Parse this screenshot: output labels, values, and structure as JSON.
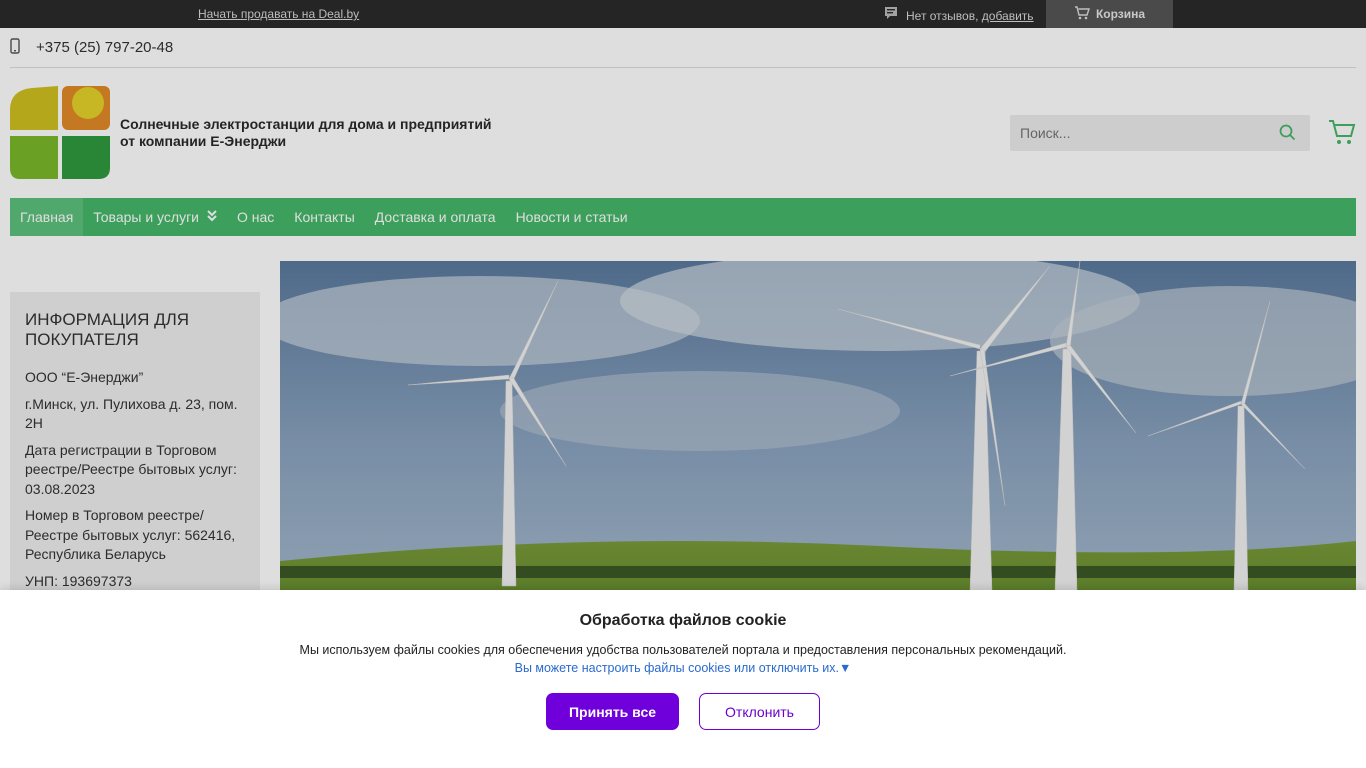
{
  "topbar": {
    "sell_link": "Начать продавать на Deal.by",
    "reviews_text": "Нет отзывов,",
    "reviews_add": "добавить",
    "cart_label": "Корзина"
  },
  "contact": {
    "phone": "+375 (25) 797-20-48"
  },
  "header": {
    "tagline_line1": "Солнечные электростанции для дома и предприятий",
    "tagline_line2": "от компании Е-Энерджи",
    "search_placeholder": "Поиск..."
  },
  "nav": {
    "items": [
      {
        "label": "Главная",
        "active": true
      },
      {
        "label": "Товары и услуги",
        "has_dropdown": true
      },
      {
        "label": "О нас"
      },
      {
        "label": "Контакты"
      },
      {
        "label": "Доставка и оплата"
      },
      {
        "label": "Новости и статьи"
      }
    ]
  },
  "sidebar": {
    "title": "ИНФОРМАЦИЯ ДЛЯ ПОКУПАТЕЛЯ",
    "company": "ООО “Е-Энерджи”",
    "address": "г.Минск, ул. Пулихова д. 23, пом. 2Н",
    "registration": "Дата регистрации в Торговом реестре/Реестре бытовых услуг: 03.08.2023",
    "register_number": "Номер в Торговом реестре/ Реестре бытовых услуг: 562416, Республика Беларусь",
    "unp": "УНП: 193697373"
  },
  "cookie": {
    "title": "Обработка файлов cookie",
    "description": "Мы используем файлы cookies для обеспечения удобства пользователей портала и предоставления персональных рекомендаций.",
    "settings_link": "Вы можете настроить файлы cookies или отключить их.▼",
    "accept_label": "Принять все",
    "decline_label": "Отклонить"
  },
  "colors": {
    "nav_green": "#46b86a",
    "accept_purple": "#7000db",
    "topbar_dark": "#2b2b2b"
  },
  "icons": [
    "mobile-phone-icon",
    "comment-icon",
    "cart-icon",
    "search-icon",
    "chevron-double-down-icon"
  ]
}
